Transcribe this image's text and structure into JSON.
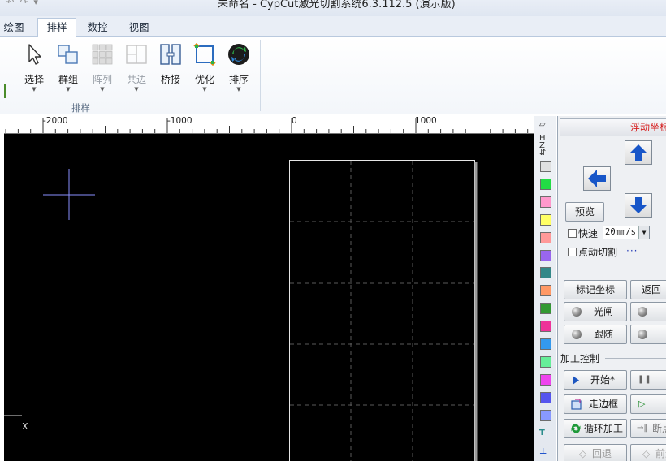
{
  "title_bar": {
    "quick_access_glyphs": "↶ ↷ ▾",
    "app_title": "未命名 - CypCut激光切割系统6.3.112.5 (演示版)"
  },
  "ribbon_tabs": [
    {
      "label": "绘图",
      "active": false
    },
    {
      "label": "排样",
      "active": true
    },
    {
      "label": "数控",
      "active": false
    },
    {
      "label": "视图",
      "active": false
    }
  ],
  "ribbon": {
    "group_label": "排样",
    "buttons": [
      {
        "label": "选择",
        "icon": "cursor-arrow-icon",
        "has_dropdown": true,
        "disabled": false
      },
      {
        "label": "群组",
        "icon": "group-icon",
        "has_dropdown": true,
        "disabled": false
      },
      {
        "label": "阵列",
        "icon": "array-grid-icon",
        "has_dropdown": true,
        "disabled": true
      },
      {
        "label": "共边",
        "icon": "common-edge-icon",
        "has_dropdown": true,
        "disabled": true
      },
      {
        "label": "桥接",
        "icon": "bridge-icon",
        "has_dropdown": false,
        "disabled": false
      },
      {
        "label": "优化",
        "icon": "optimize-icon",
        "has_dropdown": true,
        "disabled": false
      },
      {
        "label": "排序",
        "icon": "sort-icon",
        "has_dropdown": true,
        "disabled": false
      }
    ]
  },
  "ruler": {
    "labels": [
      "-2000",
      "-1000",
      "0",
      "1000"
    ]
  },
  "canvas": {
    "background": "#000000",
    "axis_label": "X"
  },
  "layers": {
    "top_glyphs": [
      "⏥",
      "H",
      "Z",
      "⇵"
    ],
    "colors": [
      "#e0e0e0",
      "#22dd44",
      "#ff99cc",
      "#ffff66",
      "#ff9999",
      "#9966ee",
      "#338888",
      "#ff9966",
      "#339933",
      "#ee3399",
      "#3399ee",
      "#66ee99",
      "#ee44ee",
      "#5555ee",
      "#8899ff"
    ],
    "bottom_glyphs": [
      "T",
      "⊥"
    ]
  },
  "panel": {
    "title": "浮动坐标",
    "preview_label": "预览",
    "fast_label": "快速",
    "speed_value": "20mm/s",
    "jog_cut_label": "点动切割",
    "more_label": "···",
    "mark_coord_label": "标记坐标",
    "return_label": "返回",
    "shutter_label": "光闸",
    "follow_label": "跟随",
    "process_control_label": "加工控制",
    "start_label": "开始*",
    "frame_label": "走边框",
    "loop_label": "循环加工",
    "back_label": "回退",
    "pause_glyph": "❚❚",
    "play_glyph": "▷",
    "break_label": "断点",
    "forward_label": "前进"
  },
  "colors": {
    "accent_red": "#d62020",
    "arrow_blue": "#1856c8",
    "ribbon_border": "#b9c9de"
  }
}
